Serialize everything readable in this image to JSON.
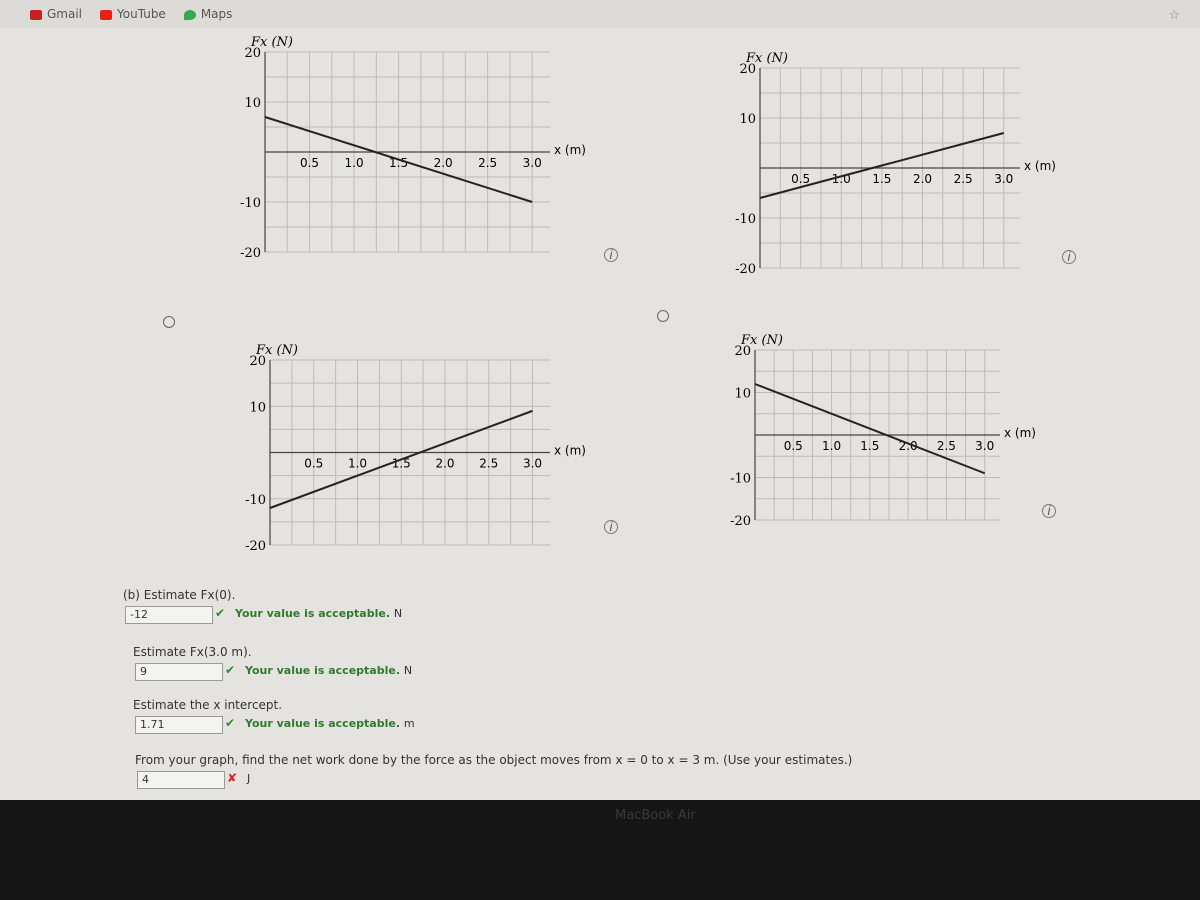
{
  "bookmarks": [
    {
      "label": "Gmail",
      "color": "#c5221f"
    },
    {
      "label": "YouTube",
      "color": "#e62117"
    },
    {
      "label": "Maps",
      "color": "#34a853"
    }
  ],
  "graph_common": {
    "ylabel": "Fx (N)",
    "xlabel": "x (m)",
    "yticks": [
      "20",
      "10",
      "-10",
      "-20"
    ],
    "xticks": [
      "0.5",
      "1.0",
      "1.5",
      "2.0",
      "2.5",
      "3.0"
    ]
  },
  "chart_data": [
    {
      "type": "line",
      "ylim": [
        -20,
        20
      ],
      "xlim": [
        0,
        3.2
      ],
      "x": [
        0,
        3
      ],
      "y": [
        7,
        -10
      ]
    },
    {
      "type": "line",
      "ylim": [
        -20,
        20
      ],
      "xlim": [
        0,
        3.2
      ],
      "x": [
        0,
        3
      ],
      "y": [
        -6,
        7
      ]
    },
    {
      "type": "line",
      "ylim": [
        -20,
        20
      ],
      "xlim": [
        0,
        3.2
      ],
      "x": [
        0,
        3
      ],
      "y": [
        -12,
        9
      ]
    },
    {
      "type": "line",
      "ylim": [
        -20,
        20
      ],
      "xlim": [
        0,
        3.2
      ],
      "x": [
        0,
        3
      ],
      "y": [
        12,
        -9
      ]
    }
  ],
  "questions": [
    {
      "prompt": "(b) Estimate Fx(0).",
      "value": "-12",
      "status": "correct",
      "feedback": "Your value is acceptable.",
      "unit": "N"
    },
    {
      "prompt": "Estimate Fx(3.0 m).",
      "value": "9",
      "status": "correct",
      "feedback": "Your value is acceptable.",
      "unit": "N"
    },
    {
      "prompt": "Estimate the x intercept.",
      "value": "1.71",
      "status": "correct",
      "feedback": "Your value is acceptable.",
      "unit": "m"
    },
    {
      "prompt": "From your graph, find the net work done by the force as the object moves from x = 0 to x = 3 m. (Use your estimates.)",
      "value": "4",
      "status": "incorrect",
      "feedback": "",
      "unit": "J"
    }
  ],
  "icons": {
    "correct": "✔",
    "incorrect": "✘",
    "info": "i"
  },
  "device_label": "MacBook Air"
}
